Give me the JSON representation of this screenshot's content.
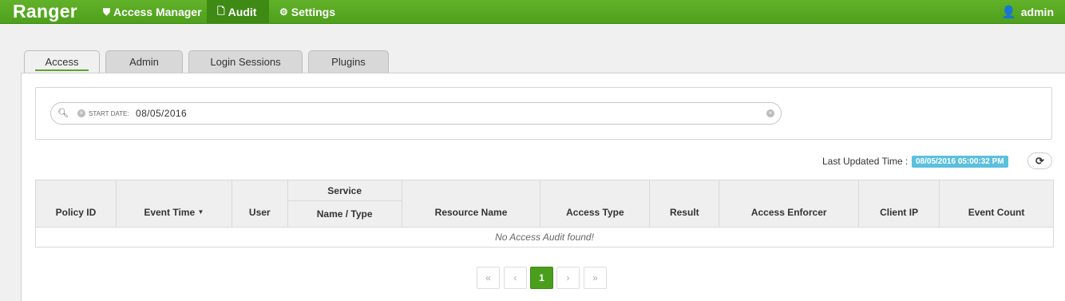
{
  "header": {
    "brand": "Ranger",
    "nav": [
      {
        "label": "Access Manager",
        "icon": "shield-icon",
        "glyph": "⛊"
      },
      {
        "label": "Audit",
        "icon": "document-icon",
        "glyph": "🗋"
      },
      {
        "label": "Settings",
        "icon": "gear-icon",
        "glyph": "⚙"
      }
    ],
    "user": {
      "label": "admin",
      "icon": "user-icon",
      "glyph": "👤"
    }
  },
  "tabs": [
    "Access",
    "Admin",
    "Login Sessions",
    "Plugins"
  ],
  "search": {
    "facet": "START DATE:",
    "value": "08/05/2016"
  },
  "last_updated": {
    "label": "Last Updated Time :",
    "value": "08/05/2016 05:00:32 PM"
  },
  "table": {
    "headers": {
      "policy_id": "Policy ID",
      "event_time": "Event Time",
      "user": "User",
      "service": "Service",
      "service_sub": "Name / Type",
      "resource_name": "Resource Name",
      "access_type": "Access Type",
      "result": "Result",
      "access_enforcer": "Access Enforcer",
      "client_ip": "Client IP",
      "event_count": "Event Count"
    },
    "empty_message": "No Access Audit found!"
  },
  "pagination": {
    "first": "«",
    "prev": "‹",
    "current": "1",
    "next": "›",
    "last": "»"
  },
  "colors": {
    "accent": "#4ea01c",
    "badge": "#5bc0de"
  }
}
